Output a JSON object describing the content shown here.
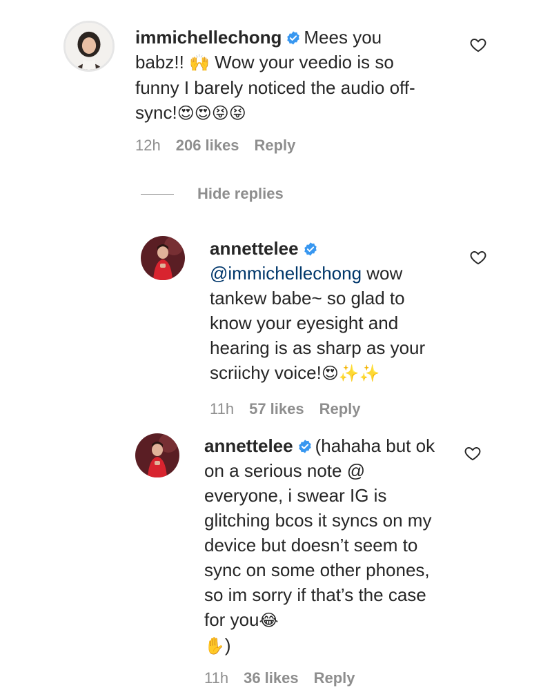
{
  "comments": [
    {
      "username": "immichellechong",
      "text_before": "Mees you babz!! ",
      "emoji1": "🙌",
      "text_after": " Wow your veedio is so funny I barely noticed the audio off-sync!",
      "emoji_tail": "😍😍😝😝",
      "time": "12h",
      "likes": "206 likes",
      "reply": "Reply"
    }
  ],
  "hide_replies": "Hide replies",
  "replies": [
    {
      "username": "annettelee",
      "mention": "@immichellechong",
      "text": " wow tankew babe~ so glad to know your eyesight and hearing is as sharp as your scriichy voice!",
      "emoji_tail": "😍✨✨",
      "time": "11h",
      "likes": "57 likes",
      "reply": "Reply"
    },
    {
      "username": "annettelee",
      "text": "(hahaha but ok on a serious note @ everyone, i swear IG is glitching bcos it syncs on my device but doesn’t seem to sync on some other phones, so im sorry if that’s the case for you",
      "emoji_tail": "😂",
      "text_end_emoji": "✋",
      "text_end": ")",
      "time": "11h",
      "likes": "36 likes",
      "reply": "Reply"
    }
  ],
  "colors": {
    "text": "#262626",
    "meta": "#8e8e8e",
    "mention": "#00376b",
    "verified": "#3897f0"
  }
}
